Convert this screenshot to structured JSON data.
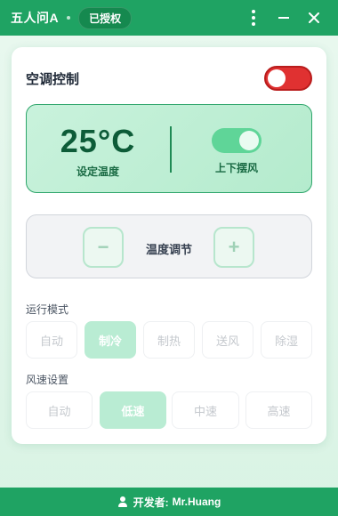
{
  "titlebar": {
    "app_title": "五人问A",
    "badge": "已授权",
    "more_icon": "kebab-menu-icon",
    "minimize_icon": "minimize-icon",
    "close_icon": "close-icon"
  },
  "card": {
    "title": "空调控制",
    "power_on": false,
    "power_color": "#e03131"
  },
  "status": {
    "temperature": "25°C",
    "temperature_label": "设定温度",
    "swing_label": "上下摆风",
    "swing_on": true
  },
  "adjust": {
    "minus": "−",
    "plus": "+",
    "label": "温度调节"
  },
  "mode": {
    "label": "运行模式",
    "options": [
      "自动",
      "制冷",
      "制热",
      "送风",
      "除湿"
    ],
    "selected": "制冷"
  },
  "fan": {
    "label": "风速设置",
    "options": [
      "自动",
      "低速",
      "中速",
      "高速"
    ],
    "selected": "低速"
  },
  "footer": {
    "label": "开发者:",
    "developer": "Mr.Huang"
  },
  "colors": {
    "primary": "#1fa363",
    "accent_light": "#b9ecd3",
    "danger": "#e03131"
  }
}
